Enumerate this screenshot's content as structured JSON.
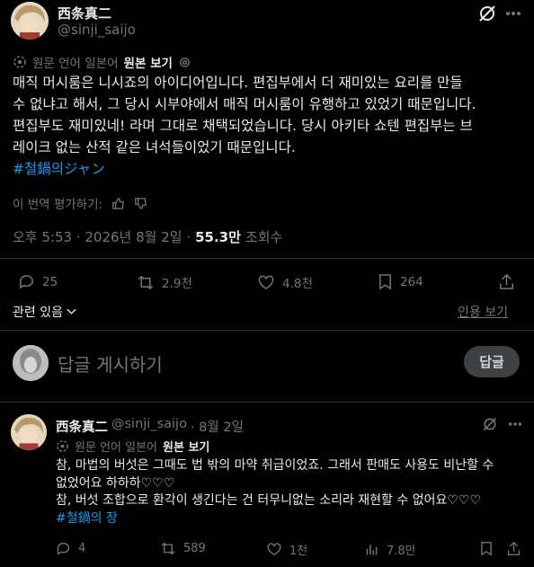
{
  "post": {
    "author_name": "西条真二",
    "author_handle": "@sinji_saijo",
    "translate_from": "원문 언어 일본어",
    "translate_show_original": "원본 보기",
    "body_lines": [
      "매직 머시룸은 니시죠의 아이디어입니다. 편집부에서 더 재미있는 요리를 만들",
      "수 없냐고 해서, 그 당시 시부야에서 매직 머시룸이 유행하고 있었기 때문입니다.",
      "편집부도 재미있네! 라며 그대로 채택되었습니다. 당시 아키타 쇼텐 편집부는 브",
      "레이크 없는 산적 같은 녀석들이었기 때문입니다."
    ],
    "hashtag": "#철鍋의ジャン",
    "rate_translation": "이 번역 평가하기:",
    "timestamp": "오후 5:53 · 2026년 8월 2일 ·",
    "views_count": "55.3만",
    "views_label": "조회수",
    "actions": {
      "replies": "25",
      "reposts": "2.9천",
      "likes": "4.8천",
      "bookmarks": "264"
    },
    "related_label": "관련 있음",
    "quotes_label": "인용 보기"
  },
  "reply_composer": {
    "placeholder": "답글 게시하기",
    "button_label": "답글"
  },
  "reply": {
    "author_name": "西条真二",
    "author_handle": "@sinji_saijo",
    "date": "· 8월 2일",
    "translate_from": "원문 언어 일본어",
    "translate_show_original": "원본 보기",
    "body_lines": [
      "참, 마법의 버섯은 그때도 법 밖의 마약 취급이었죠. 그래서 판매도 사용도 비난할 수",
      "없었어요 하하하♡♡♡",
      "참, 버섯 조합으로 환각이 생긴다는 건 터무니없는 소리라 재현할 수 없어요♡♡♡"
    ],
    "hashtag": "#철鍋의 장",
    "actions": {
      "replies": "4",
      "reposts": "589",
      "likes": "1천",
      "views": "7.8만"
    }
  },
  "colors": {
    "background": "#000000",
    "text": "#e7e9ea",
    "muted": "#71767b",
    "link": "#1d9bf0",
    "divider": "#2f3336"
  }
}
